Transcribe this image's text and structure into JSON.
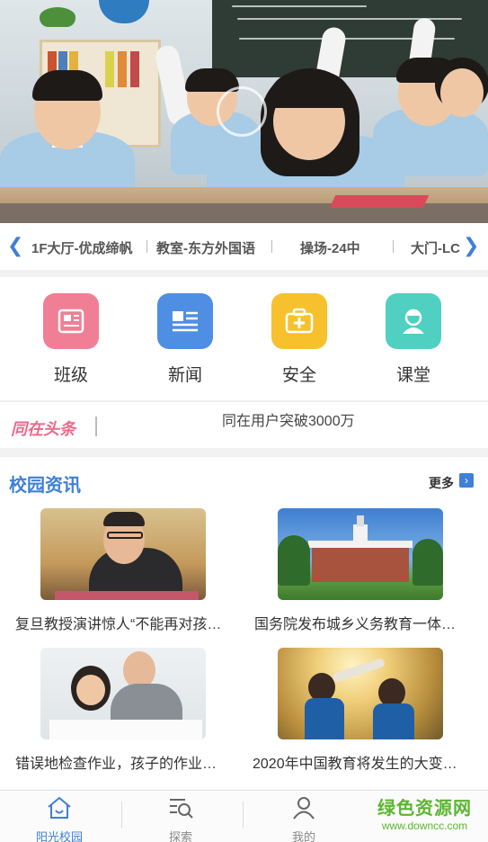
{
  "cameras": {
    "items": [
      "1F大厅-优成缔帆",
      "教室-东方外国语",
      "操场-24中",
      "大门-LC"
    ]
  },
  "categories": [
    {
      "label": "班级",
      "icon": "newspaper-icon",
      "color": "#f07f95"
    },
    {
      "label": "新闻",
      "icon": "news-list-icon",
      "color": "#4f8fe3"
    },
    {
      "label": "安全",
      "icon": "first-aid-kit-icon",
      "color": "#f7c12d"
    },
    {
      "label": "课堂",
      "icon": "student-avatar-icon",
      "color": "#4fd0c0"
    }
  ],
  "headline": {
    "brand": "同在头条",
    "text": "同在用户突破3000万"
  },
  "news": {
    "title": "校园资讯",
    "more_label": "更多",
    "items": [
      {
        "caption": "复旦教授演讲惊人“不能再对孩…"
      },
      {
        "caption": "国务院发布城乡义务教育一体…"
      },
      {
        "caption": "错误地检查作业，孩子的作业…"
      },
      {
        "caption": "2020年中国教育将发生的大变…"
      }
    ]
  },
  "tabbar": {
    "tabs": [
      {
        "label": "阳光校园",
        "icon": "home-icon",
        "active": true
      },
      {
        "label": "探索",
        "icon": "search-list-icon",
        "active": false
      },
      {
        "label": "我的",
        "icon": "user-icon",
        "active": false
      }
    ]
  },
  "watermark": {
    "line1": "绿色资源网",
    "line2": "www.downcc.com"
  },
  "colors": {
    "accent": "#3f7fd6",
    "brand_pink": "#ea6b8a",
    "watermark_green": "#5cb531"
  }
}
